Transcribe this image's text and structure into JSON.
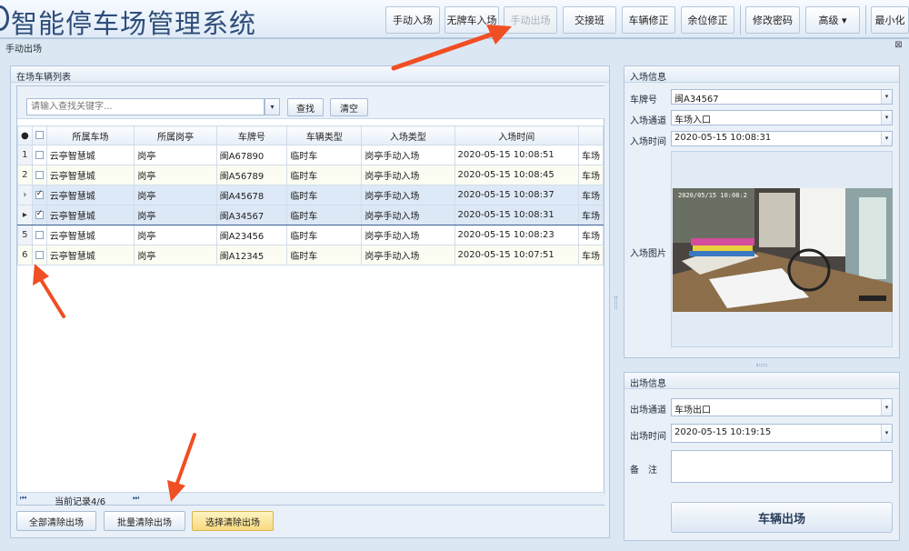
{
  "app": {
    "title": "智能停车场管理系统"
  },
  "toolbar": {
    "buttons": [
      {
        "label": "手动入场"
      },
      {
        "label": "无牌车入场"
      },
      {
        "label": "手动出场"
      },
      {
        "label": "交接班"
      },
      {
        "label": "车辆修正"
      },
      {
        "label": "余位修正"
      },
      {
        "label": "修改密码"
      },
      {
        "label": "高级 ▾"
      },
      {
        "label": "最小化"
      }
    ]
  },
  "window": {
    "title": "手动出场",
    "close": "⊠"
  },
  "left": {
    "panel_title": "在场车辆列表",
    "search": {
      "placeholder": "请输入查找关键字...",
      "find_label": "查找",
      "clear_label": "清空"
    },
    "columns": [
      "所属车场",
      "所属岗亭",
      "车牌号",
      "车辆类型",
      "入场类型",
      "入场时间"
    ],
    "rows": [
      {
        "idx": "1",
        "checked": false,
        "lot": "云亭智慧城",
        "booth": "岗亭",
        "plate": "闽A67890",
        "type": "临时车",
        "entry_type": "岗亭手动入场",
        "time": "2020-05-15 10:08:51",
        "more": "车场"
      },
      {
        "idx": "2",
        "checked": false,
        "lot": "云亭智慧城",
        "booth": "岗亭",
        "plate": "闽A56789",
        "type": "临时车",
        "entry_type": "岗亭手动入场",
        "time": "2020-05-15 10:08:45",
        "more": "车场"
      },
      {
        "idx": "›",
        "checked": true,
        "lot": "云亭智慧城",
        "booth": "岗亭",
        "plate": "闽A45678",
        "type": "临时车",
        "entry_type": "岗亭手动入场",
        "time": "2020-05-15 10:08:37",
        "more": "车场"
      },
      {
        "idx": "▸",
        "checked": true,
        "lot": "云亭智慧城",
        "booth": "岗亭",
        "plate": "闽A34567",
        "type": "临时车",
        "entry_type": "岗亭手动入场",
        "time": "2020-05-15 10:08:31",
        "more": "车场"
      },
      {
        "idx": "5",
        "checked": false,
        "lot": "云亭智慧城",
        "booth": "岗亭",
        "plate": "闽A23456",
        "type": "临时车",
        "entry_type": "岗亭手动入场",
        "time": "2020-05-15 10:08:23",
        "more": "车场"
      },
      {
        "idx": "6",
        "checked": false,
        "lot": "云亭智慧城",
        "booth": "岗亭",
        "plate": "闽A12345",
        "type": "临时车",
        "entry_type": "岗亭手动入场",
        "time": "2020-05-15 10:07:51",
        "more": "车场"
      }
    ],
    "pager": {
      "first": "⏮",
      "record": "当前记录4/6",
      "last": "⏭"
    },
    "actions": {
      "clear_all": "全部清除出场",
      "batch_clear": "批量清除出场",
      "select_clear": "选择清除出场"
    }
  },
  "entry": {
    "title": "入场信息",
    "plate_label": "车牌号",
    "plate": "闽A34567",
    "channel_label": "入场通道",
    "channel": "车场入口",
    "time_label": "入场时间",
    "time": "2020-05-15 10:08:31",
    "image_label": "入场图片",
    "image_timestamp": "2020/05/15 10:08:2"
  },
  "exit": {
    "title": "出场信息",
    "channel_label": "出场通道",
    "channel": "车场出口",
    "time_label": "出场时间",
    "time": "2020-05-15 10:19:15",
    "remark_label": "备　注",
    "remark": "",
    "button": "车辆出场"
  },
  "colors": {
    "accent": "#2f4d7a",
    "highlight": "#f8d97e",
    "annotation": "#f04e23"
  }
}
